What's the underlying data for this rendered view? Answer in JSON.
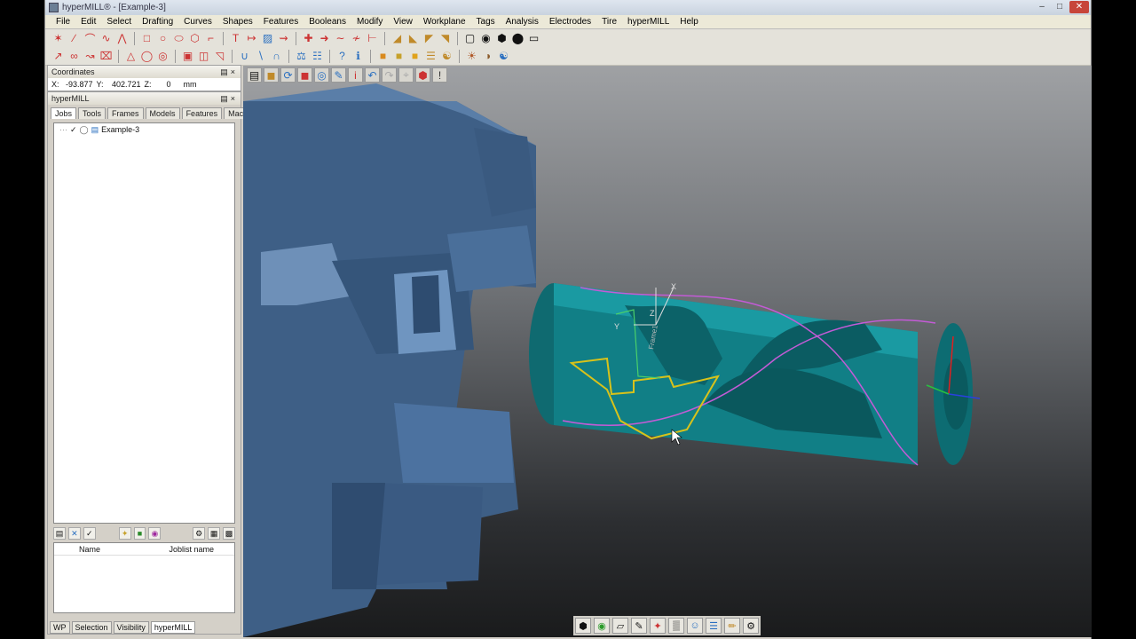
{
  "window": {
    "title": "hyperMILL® - [Example-3]"
  },
  "menu": [
    "File",
    "Edit",
    "Select",
    "Drafting",
    "Curves",
    "Shapes",
    "Features",
    "Booleans",
    "Modify",
    "View",
    "Workplane",
    "Tags",
    "Analysis",
    "Electrodes",
    "Tire",
    "hyperMILL",
    "Help"
  ],
  "coordinates": {
    "title": "Coordinates",
    "x_label": "X:",
    "x": "-93.877",
    "y_label": "Y:",
    "y": "402.721",
    "z_label": "Z:",
    "z": "0",
    "unit": "mm"
  },
  "panel": {
    "title": "hyperMILL",
    "tabs": [
      "Jobs",
      "Tools",
      "Frames",
      "Models",
      "Features",
      "Macros"
    ],
    "tree_item": "Example-3",
    "list_headers": [
      "Name",
      "Joblist name"
    ],
    "bottom_tabs": [
      "WP",
      "Selection",
      "Visibility",
      "hyperMILL"
    ]
  },
  "viewport": {
    "bg_top": "#9fa1a4",
    "bg_bottom": "#1a1b1c",
    "part_color": "#117f86",
    "chuck_color": "#3e5f86",
    "contour_color": "#d8c21a",
    "wcs_labels": {
      "x": "X",
      "y": "Y",
      "z": "Z"
    },
    "frame_label": "Frame1"
  },
  "icons": {
    "close": "close-icon",
    "minimize": "minimize-icon",
    "maximize": "maximize-icon"
  }
}
